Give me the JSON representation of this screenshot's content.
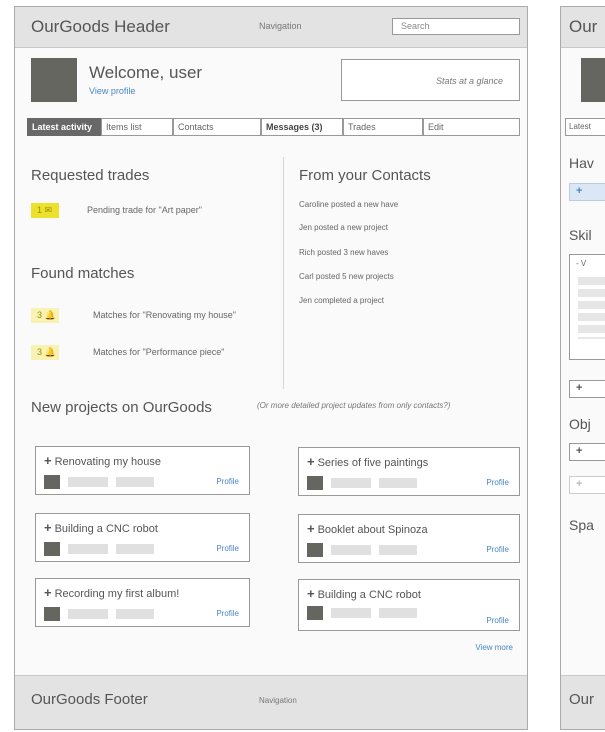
{
  "header": {
    "title": "OurGoods Header",
    "nav": "Navigation",
    "search_placeholder": "Search"
  },
  "welcome": {
    "title": "Welcome, user",
    "profile_link": "View profile",
    "stats": "Stats at a glance"
  },
  "tabs": [
    {
      "label": "Latest activity",
      "state": "active"
    },
    {
      "label": "Items list",
      "state": "normal"
    },
    {
      "label": "Contacts",
      "state": "normal"
    },
    {
      "label": "Messages (3)",
      "state": "bold"
    },
    {
      "label": "Trades",
      "state": "normal"
    },
    {
      "label": "Edit",
      "state": "normal"
    }
  ],
  "requested_trades": {
    "title": "Requested trades",
    "items": [
      {
        "badge": "1 ✉",
        "text": "Pending trade for \"Art paper\""
      }
    ]
  },
  "found_matches": {
    "title": "Found matches",
    "items": [
      {
        "badge": "3 🔔",
        "text": "Matches for \"Renovating my house\""
      },
      {
        "badge": "3 🔔",
        "text": "Matches for \"Performance piece\""
      }
    ]
  },
  "contacts": {
    "title": "From your Contacts",
    "items": [
      "Caroline posted a new have",
      "Jen posted a new project",
      "Rich posted 3 new haves",
      "Carl posted 5 new projects",
      "Jen completed a project"
    ]
  },
  "new_projects": {
    "title": "New projects on OurGoods",
    "note": "(Or more detailed project updates from only contacts?)",
    "cards": [
      {
        "title": "Renovating my house",
        "link": "Profile"
      },
      {
        "title": "Series of five paintings",
        "link": "Profile"
      },
      {
        "title": "Building a CNC robot",
        "link": "Profile"
      },
      {
        "title": "Booklet about Spinoza",
        "link": "Profile"
      },
      {
        "title": "Recording my first album!",
        "link": "Profile"
      },
      {
        "title": "Building a CNC robot",
        "link": "Profile"
      }
    ],
    "view_more": "View more"
  },
  "footer": {
    "title": "OurGoods Footer",
    "nav": "Navigation"
  },
  "side_panel": {
    "header": "Our",
    "tab": "Latest",
    "haves": "Hav",
    "skills": "Skil",
    "skills_select": "- V",
    "objects": "Obj",
    "spaces": "Spa",
    "footer": "Our"
  },
  "colors": {
    "accent_link": "#4a86c5",
    "highlight": "#ece12c",
    "highlight_light": "#f8f2b3",
    "header_bg": "#e3e3e3",
    "avatar": "#666661"
  }
}
